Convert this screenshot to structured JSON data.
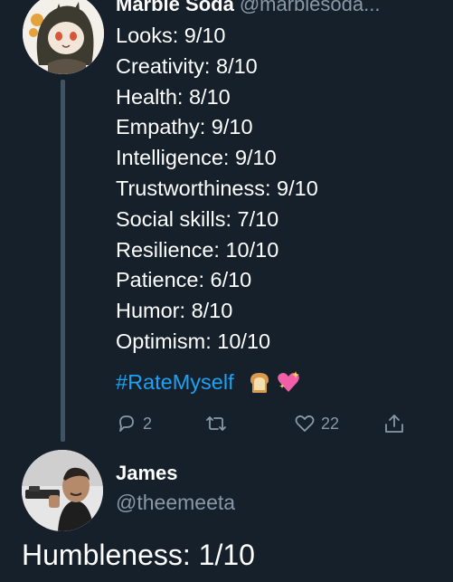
{
  "tweet": {
    "author_name": "Marble Soda",
    "author_handle": "@marblesoda...",
    "ratings": [
      "Looks: 9/10",
      "Creativity: 8/10",
      "Health: 8/10",
      "Empathy: 9/10",
      "Intelligence: 9/10",
      "Trustworthiness: 9/10",
      "Social skills: 7/10",
      "Resilience: 10/10",
      "Patience: 6/10",
      "Humor: 8/10",
      "Optimism: 10/10"
    ],
    "hashtag": "#RateMyself",
    "emojis": [
      "bread-emoji",
      "sparkling-heart-emoji"
    ],
    "actions": {
      "reply_count": "2",
      "retweet_count": "",
      "like_count": "22"
    },
    "colors": {
      "background": "#15202b",
      "hashtag": "#1da1f2",
      "secondary_text": "#8899a6",
      "thread_line": "#3d5466"
    }
  },
  "reply": {
    "author_name": "James",
    "author_handle": "@theemeeta",
    "text": "Humbleness: 1/10"
  }
}
